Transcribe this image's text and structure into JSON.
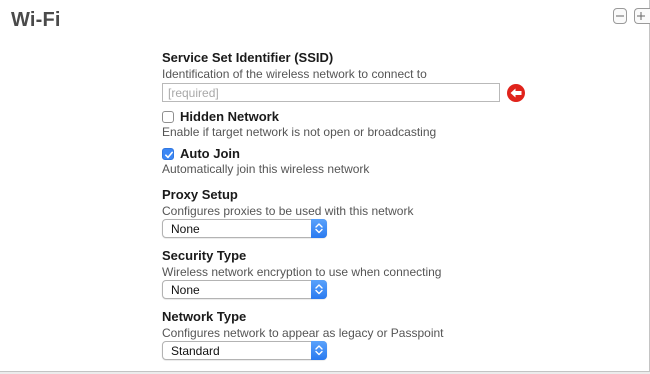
{
  "header": {
    "title": "Wi-Fi",
    "minus_symbol": "−",
    "plus_symbol": "+"
  },
  "ssid": {
    "label": "Service Set Identifier (SSID)",
    "description": "Identification of the wireless network to connect to",
    "value": "",
    "placeholder": "[required]",
    "warning_icon": "error-arrow-icon",
    "warning_color": "#e0231b"
  },
  "hidden_network": {
    "label": "Hidden Network",
    "checked": false,
    "description": "Enable if target network is not open or broadcasting"
  },
  "auto_join": {
    "label": "Auto Join",
    "checked": true,
    "description": "Automatically join this wireless network"
  },
  "proxy_setup": {
    "label": "Proxy Setup",
    "description": "Configures proxies to be used with this network",
    "selected": "None"
  },
  "security_type": {
    "label": "Security Type",
    "description": "Wireless network encryption to use when connecting",
    "selected": "None"
  },
  "network_type": {
    "label": "Network Type",
    "description": "Configures network to appear as legacy or Passpoint",
    "selected": "Standard"
  },
  "colors": {
    "accent": "#3b87f5",
    "error": "#e0231b"
  }
}
